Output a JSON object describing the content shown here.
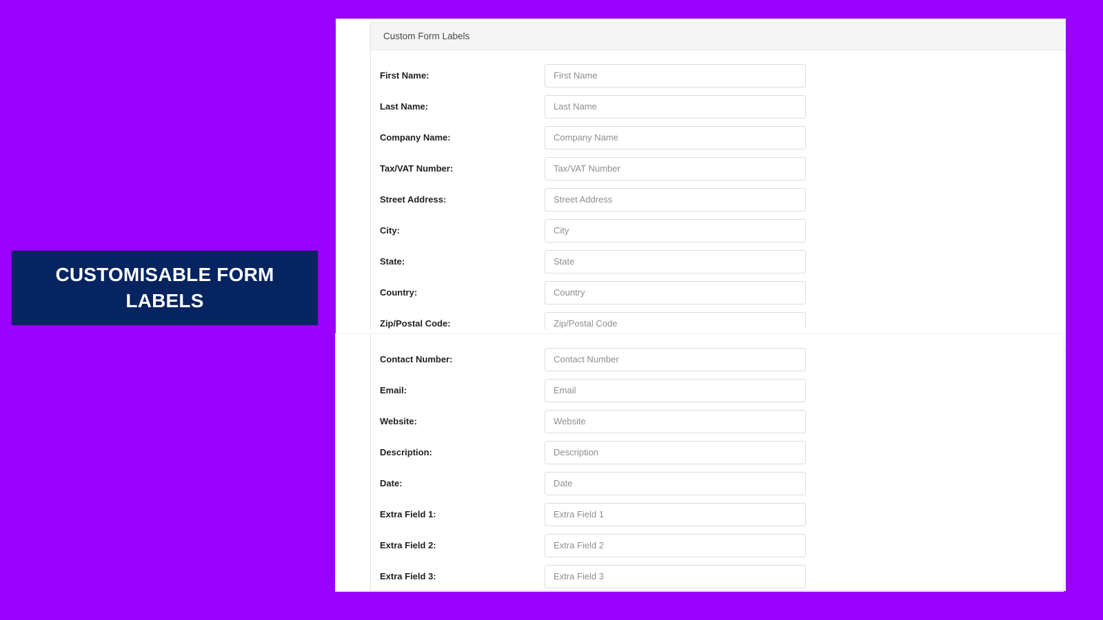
{
  "theme": {
    "page_background": "#9900ff",
    "banner_background": "#052460",
    "banner_text_color": "#ffffff",
    "card_background": "#ffffff",
    "card_header_background": "#f5f5f5",
    "input_border": "#dcdcdc",
    "label_color": "#1f1f1f",
    "placeholder_color": "#8d8d8d"
  },
  "promo": {
    "title": "CUSTOMISABLE FORM LABELS"
  },
  "card": {
    "header_title": "Custom Form Labels"
  },
  "form": {
    "fields": [
      {
        "label": "First Name:",
        "placeholder": "First Name",
        "value": "",
        "name": "first-name"
      },
      {
        "label": "Last Name:",
        "placeholder": "Last Name",
        "value": "",
        "name": "last-name"
      },
      {
        "label": "Company Name:",
        "placeholder": "Company Name",
        "value": "",
        "name": "company-name"
      },
      {
        "label": "Tax/VAT Number:",
        "placeholder": "Tax/VAT Number",
        "value": "",
        "name": "tax-vat-number"
      },
      {
        "label": "Street Address:",
        "placeholder": "Street Address",
        "value": "",
        "name": "street-address"
      },
      {
        "label": "City:",
        "placeholder": "City",
        "value": "",
        "name": "city"
      },
      {
        "label": "State:",
        "placeholder": "State",
        "value": "",
        "name": "state"
      },
      {
        "label": "Country:",
        "placeholder": "Country",
        "value": "",
        "name": "country"
      },
      {
        "label": "Zip/Postal Code:",
        "placeholder": "Zip/Postal Code",
        "value": "",
        "name": "zip-postal-code"
      }
    ],
    "fields_lower": [
      {
        "label": "Contact Number:",
        "placeholder": "Contact Number",
        "value": "",
        "name": "contact-number"
      },
      {
        "label": "Email:",
        "placeholder": "Email",
        "value": "",
        "name": "email"
      },
      {
        "label": "Website:",
        "placeholder": "Website",
        "value": "",
        "name": "website"
      },
      {
        "label": "Description:",
        "placeholder": "Description",
        "value": "",
        "name": "description"
      },
      {
        "label": "Date:",
        "placeholder": "Date",
        "value": "",
        "name": "date"
      },
      {
        "label": "Extra Field 1:",
        "placeholder": "Extra Field 1",
        "value": "",
        "name": "extra-field-1"
      },
      {
        "label": "Extra Field 2:",
        "placeholder": "Extra Field 2",
        "value": "",
        "name": "extra-field-2"
      },
      {
        "label": "Extra Field 3:",
        "placeholder": "Extra Field 3",
        "value": "",
        "name": "extra-field-3"
      }
    ]
  }
}
